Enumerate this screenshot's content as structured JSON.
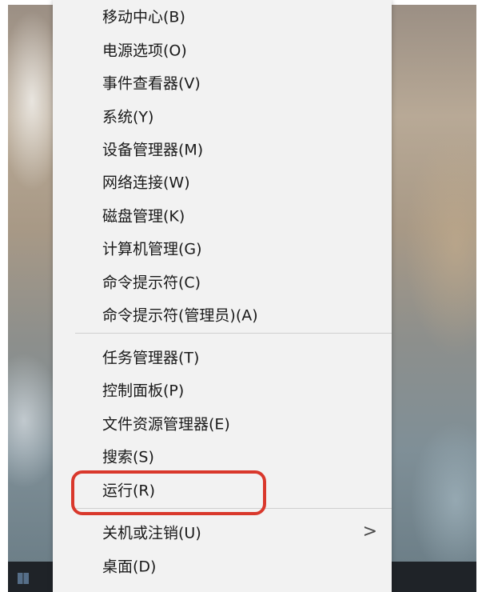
{
  "menu": {
    "items": [
      {
        "label": "移动中心(B)"
      },
      {
        "label": "电源选项(O)"
      },
      {
        "label": "事件查看器(V)"
      },
      {
        "label": "系统(Y)"
      },
      {
        "label": "设备管理器(M)"
      },
      {
        "label": "网络连接(W)"
      },
      {
        "label": "磁盘管理(K)"
      },
      {
        "label": "计算机管理(G)"
      },
      {
        "label": "命令提示符(C)"
      },
      {
        "label": "命令提示符(管理员)(A)"
      },
      {
        "label": "任务管理器(T)"
      },
      {
        "label": "控制面板(P)"
      },
      {
        "label": "文件资源管理器(E)"
      },
      {
        "label": "搜索(S)"
      },
      {
        "label": "运行(R)"
      },
      {
        "label": "关机或注销(U)",
        "submenu_indicator": ">"
      },
      {
        "label": "桌面(D)"
      }
    ]
  },
  "highlight": {
    "target": "运行(R)",
    "color": "#d9382c"
  },
  "colors": {
    "menu_bg": "#f2f2f2",
    "separator": "#cfcfcf",
    "text": "#1a1a1a",
    "taskbar": "#1f2328"
  }
}
